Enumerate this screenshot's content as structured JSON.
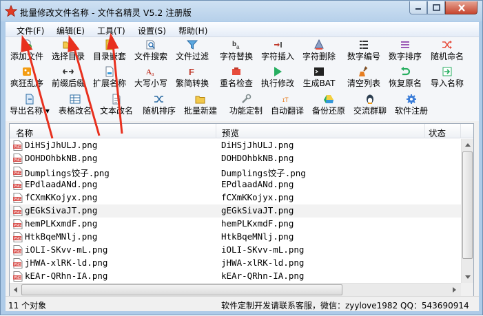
{
  "window": {
    "title": "批量修改文件名称 - 文件名精灵 V5.2 注册版"
  },
  "menu": [
    "文件(F)",
    "编辑(E)",
    "工具(T)",
    "设置(S)",
    "帮助(H)"
  ],
  "toolbar": {
    "row1": [
      "添加文件",
      "选择目录",
      "目录嵌套",
      "文件搜索",
      "文件过滤",
      "字符替换",
      "字符插入",
      "字符删除",
      "数字编号",
      "数字排序",
      "随机命名"
    ],
    "row2": [
      "疯狂乱序",
      "前缀后缀",
      "扩展名称",
      "大写小写",
      "繁简转换",
      "重名检查",
      "执行修改",
      "生成BAT",
      "清空列表",
      "恢复原名",
      "导入名称"
    ],
    "row3": [
      "导出名称",
      "表格改名",
      "文本改名",
      "随机排序",
      "批量新建",
      "功能定制",
      "自动翻译",
      "备份还原",
      "交流群聊",
      "软件注册"
    ]
  },
  "grid": {
    "columns": [
      "名称",
      "预览",
      "状态"
    ],
    "rows": [
      {
        "name": "DiHSjJhULJ.png",
        "preview": "DiHSjJhULJ.png"
      },
      {
        "name": "DOHDOhbkNB.png",
        "preview": "DOHDOhbkNB.png"
      },
      {
        "name": "Dumplings饺子.png",
        "preview": "Dumplings饺子.png"
      },
      {
        "name": "EPdlaadANd.png",
        "preview": "EPdlaadANd.png"
      },
      {
        "name": "fCXmKKojyx.png",
        "preview": "fCXmKKojyx.png"
      },
      {
        "name": "gEGkSivaJT.png",
        "preview": "gEGkSivaJT.png"
      },
      {
        "name": "hemPLKxmdF.png",
        "preview": "hemPLKxmdF.png"
      },
      {
        "name": "HtkBqeMNlj.png",
        "preview": "HtkBqeMNlj.png"
      },
      {
        "name": "iOLI-SKvv-mL.png",
        "preview": "iOLI-SKvv-mL.png"
      },
      {
        "name": "jHWA-xlRK-ld.png",
        "preview": "jHWA-xlRK-ld.png"
      },
      {
        "name": "kEAr-QRhn-IA.png",
        "preview": "kEAr-QRhn-IA.png"
      }
    ],
    "file_badge": "PNG"
  },
  "status": {
    "count": "11 个对象",
    "contact": "软件定制开发请联系客服，微信：zyylove1982   QQ：543690914"
  },
  "colors": {
    "title_bg": "#b6d0ea",
    "close_button": "#c7452f",
    "annotation_arrow": "#e8301e",
    "alt_row": "#f2f2f2"
  }
}
